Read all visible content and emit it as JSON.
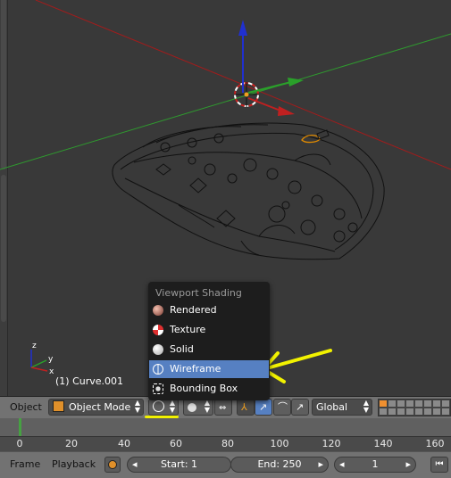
{
  "viewport": {
    "object_label": "(1) Curve.001"
  },
  "menu": {
    "title": "Viewport Shading",
    "items": [
      {
        "label": "Rendered",
        "icon": "rendered-sphere-icon",
        "active": false
      },
      {
        "label": "Texture",
        "icon": "texture-checker-icon",
        "active": false
      },
      {
        "label": "Solid",
        "icon": "solid-sphere-icon",
        "active": false
      },
      {
        "label": "Wireframe",
        "icon": "wireframe-globe-icon",
        "active": true
      },
      {
        "label": "Bounding Box",
        "icon": "bounding-box-icon",
        "active": false
      }
    ]
  },
  "header": {
    "object_menu": "Object",
    "mode": "Object Mode",
    "orientation": "Global"
  },
  "timeline": {
    "ticks": [
      "0",
      "20",
      "40",
      "60",
      "80",
      "100",
      "120",
      "140",
      "160"
    ]
  },
  "bottom": {
    "frame_label": "Frame",
    "playback_label": "Playback",
    "start": "Start: 1",
    "end": "End: 250",
    "current": "1"
  },
  "colors": {
    "highlight": "#5680c2",
    "annotation": "#f2f200",
    "x_axis": "#b02020",
    "y_axis": "#2aa02a",
    "z_axis": "#2030d0"
  }
}
